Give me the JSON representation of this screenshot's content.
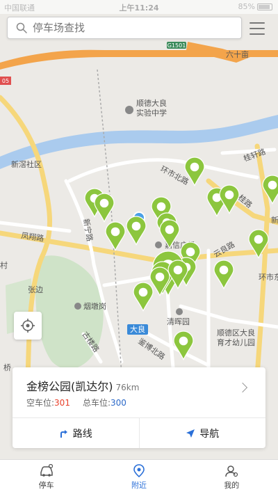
{
  "status": {
    "carrier": "中国联通",
    "time": "上午11:24",
    "battery": "85%"
  },
  "search": {
    "placeholder": "停车场查找"
  },
  "map_labels": {
    "road_g1501": "G1501",
    "liushimu": "六十亩",
    "num_105": "05",
    "shunde_school": "顺德大良",
    "shunde_school2": "实验中学",
    "xinwan": "新滘社区",
    "huanshi_north": "环市北路",
    "guixuan": "桂轩路",
    "guijing": "桂路",
    "xinning": "新宁路",
    "fengxiang": "凤翔路",
    "jiaxin": "嘉信广场",
    "yunliang": "云良路",
    "huanshi_east": "环市东路",
    "cun": "村",
    "zhangbian": "张边",
    "yandungang": "烟墩岗",
    "daliang": "大良",
    "qinghui": "清晖园",
    "gulou": "古楼路",
    "jianbo": "鉴博北路",
    "shunde_kinder": "顺德区大良",
    "shunde_kinder2": "育才幼儿园",
    "qiao": "桥",
    "xin": "新"
  },
  "card": {
    "name": "金榜公园(凯达尔)",
    "distance": "76km",
    "free_label": "空车位:",
    "free_value": "301",
    "total_label": "总车位:",
    "total_value": "300",
    "route_label": "路线",
    "nav_label": "导航"
  },
  "tabs": [
    {
      "label": "停车",
      "icon": "car-icon"
    },
    {
      "label": "附近",
      "icon": "location-pin-icon"
    },
    {
      "label": "我的",
      "icon": "user-icon"
    }
  ],
  "colors": {
    "accent": "#2a6fd8",
    "marker": "#8cc63e",
    "river": "#aacbee",
    "free": "#e8402a",
    "total": "#2a68c8"
  }
}
